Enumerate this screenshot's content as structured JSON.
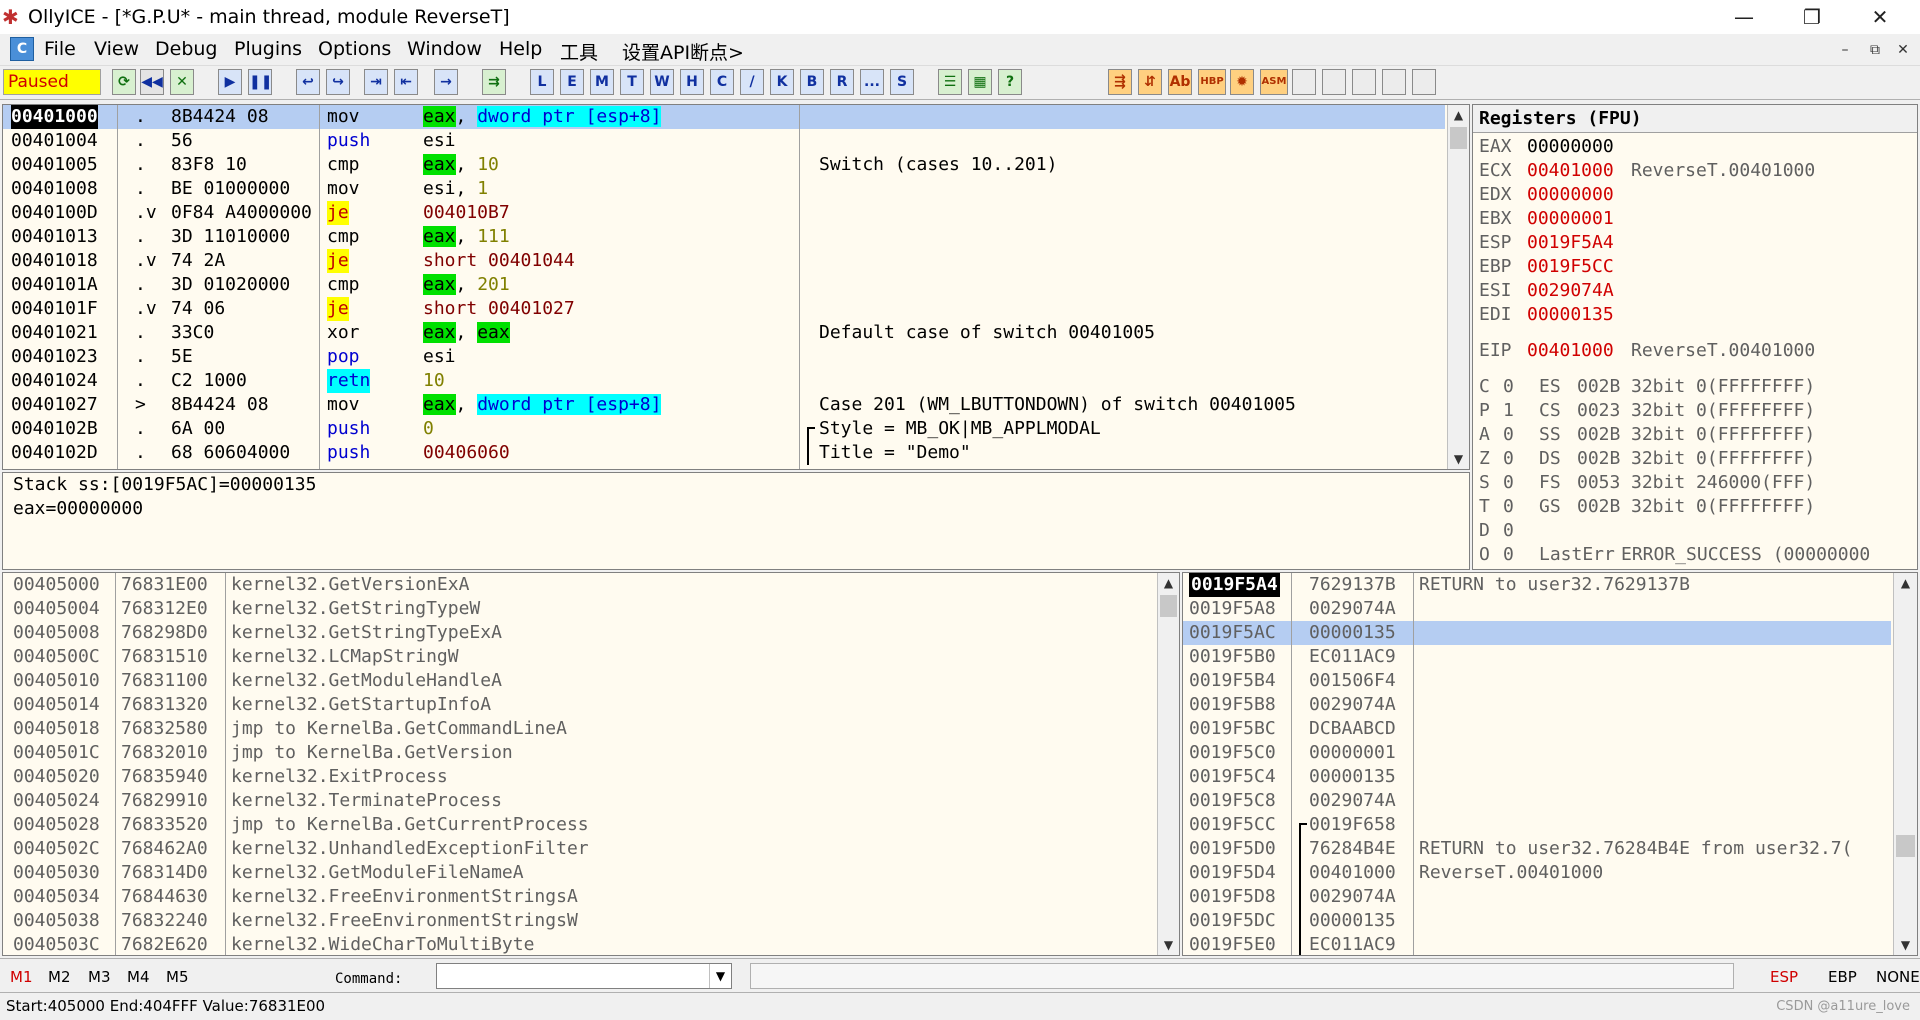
{
  "window": {
    "title": "OllyICE - [*G.P.U* - main thread, module ReverseT]",
    "minimize": "—",
    "restore": "❐",
    "close": "✕"
  },
  "menu": {
    "items": [
      "File",
      "View",
      "Debug",
      "Plugins",
      "Options",
      "Window",
      "Help",
      "工具",
      "设置API断点>"
    ],
    "mdi_buttons": [
      "–",
      "⧉",
      "✕"
    ]
  },
  "toolbar": {
    "status": "Paused",
    "buttons": [
      "⟳",
      "◀◀",
      "✕",
      "▶",
      "❚❚",
      "↩",
      "↪",
      "⇥",
      "⇤",
      "→",
      "⇉",
      "L",
      "E",
      "M",
      "T",
      "W",
      "H",
      "C",
      "/",
      "K",
      "B",
      "R",
      "...",
      "S",
      "☰",
      "▦",
      "?",
      "⇶",
      "⇵",
      "Ab",
      "HBP",
      "✹",
      "ASM"
    ]
  },
  "colors": {
    "selection": "#b5cdf2",
    "pane_bg": "#fffbf0",
    "reg_changed": "#d00000",
    "operand_reg_bg": "#00e000",
    "mem_operand_bg": "#00ffff",
    "jump_bg": "#ffff00"
  },
  "disasm": {
    "rows": [
      {
        "addr": "00401000",
        "mark": ".",
        "hex": "8B4424 08",
        "op": "mov",
        "args": [
          {
            "t": "eax",
            "s": "reg"
          },
          {
            "t": ", ",
            "s": ""
          },
          {
            "t": "dword ptr [esp+8]",
            "s": "mem"
          }
        ],
        "comment": "",
        "selected": true
      },
      {
        "addr": "00401004",
        "mark": ".",
        "hex": "56",
        "op": "push",
        "opstyle": "blue",
        "args": [
          {
            "t": "esi",
            "s": ""
          }
        ],
        "comment": ""
      },
      {
        "addr": "00401005",
        "mark": ".",
        "hex": "83F8 10",
        "op": "cmp",
        "args": [
          {
            "t": "eax",
            "s": "reg"
          },
          {
            "t": ", ",
            "s": ""
          },
          {
            "t": "10",
            "s": "num"
          }
        ],
        "comment": "Switch (cases 10..201)"
      },
      {
        "addr": "00401008",
        "mark": ".",
        "hex": "BE 01000000",
        "op": "mov",
        "args": [
          {
            "t": "esi",
            "s": ""
          },
          {
            "t": ", ",
            "s": ""
          },
          {
            "t": "1",
            "s": "num"
          }
        ],
        "comment": ""
      },
      {
        "addr": "0040100D",
        "mark": ".v",
        "hex": "0F84 A4000000",
        "op": "je",
        "opstyle": "jump",
        "args": [
          {
            "t": "004010B7",
            "s": "addr"
          }
        ],
        "comment": ""
      },
      {
        "addr": "00401013",
        "mark": ".",
        "hex": "3D 11010000",
        "op": "cmp",
        "args": [
          {
            "t": "eax",
            "s": "reg"
          },
          {
            "t": ", ",
            "s": ""
          },
          {
            "t": "111",
            "s": "num"
          }
        ],
        "comment": ""
      },
      {
        "addr": "00401018",
        "mark": ".v",
        "hex": "74 2A",
        "op": "je",
        "opstyle": "jump",
        "args": [
          {
            "t": "short 00401044",
            "s": "addr"
          }
        ],
        "comment": ""
      },
      {
        "addr": "0040101A",
        "mark": ".",
        "hex": "3D 01020000",
        "op": "cmp",
        "args": [
          {
            "t": "eax",
            "s": "reg"
          },
          {
            "t": ", ",
            "s": ""
          },
          {
            "t": "201",
            "s": "num"
          }
        ],
        "comment": ""
      },
      {
        "addr": "0040101F",
        "mark": ".v",
        "hex": "74 06",
        "op": "je",
        "opstyle": "jump",
        "args": [
          {
            "t": "short 00401027",
            "s": "addr"
          }
        ],
        "comment": ""
      },
      {
        "addr": "00401021",
        "mark": ".",
        "hex": "33C0",
        "op": "xor",
        "args": [
          {
            "t": "eax",
            "s": "reg"
          },
          {
            "t": ", ",
            "s": ""
          },
          {
            "t": "eax",
            "s": "reg"
          }
        ],
        "comment": "Default case of switch 00401005"
      },
      {
        "addr": "00401023",
        "mark": ".",
        "hex": "5E",
        "op": "pop",
        "opstyle": "blue",
        "args": [
          {
            "t": "esi",
            "s": ""
          }
        ],
        "comment": ""
      },
      {
        "addr": "00401024",
        "mark": ".",
        "hex": "C2 1000",
        "op": "retn",
        "opstyle": "ret",
        "args": [
          {
            "t": "10",
            "s": "num"
          }
        ],
        "comment": ""
      },
      {
        "addr": "00401027",
        "mark": ">",
        "hex": "8B4424 08",
        "op": "mov",
        "args": [
          {
            "t": "eax",
            "s": "reg"
          },
          {
            "t": ", ",
            "s": ""
          },
          {
            "t": "dword ptr [esp+8]",
            "s": "mem"
          }
        ],
        "comment": "Case 201 (WM_LBUTTONDOWN) of switch 00401005"
      },
      {
        "addr": "0040102B",
        "mark": ".",
        "hex": "6A 00",
        "op": "push",
        "opstyle": "blue",
        "args": [
          {
            "t": "0",
            "s": "num"
          }
        ],
        "comment": "Style = MB_OK|MB_APPLMODAL",
        "bracket": "start"
      },
      {
        "addr": "0040102D",
        "mark": ".",
        "hex": "68 60604000",
        "op": "push",
        "opstyle": "blue",
        "args": [
          {
            "t": "00406060",
            "s": "addr"
          }
        ],
        "comment": "Title = \"Demo\"",
        "bracket": "mid"
      }
    ]
  },
  "info": {
    "line1": "Stack ss:[0019F5AC]=00000135",
    "line2": "eax=00000000"
  },
  "registers": {
    "header": "Registers (FPU)",
    "gp": [
      {
        "name": "EAX",
        "value": "00000000",
        "note": "",
        "changed": false
      },
      {
        "name": "ECX",
        "value": "00401000",
        "note": "ReverseT.00401000",
        "changed": true
      },
      {
        "name": "EDX",
        "value": "00000000",
        "note": "",
        "changed": true
      },
      {
        "name": "EBX",
        "value": "00000001",
        "note": "",
        "changed": true
      },
      {
        "name": "ESP",
        "value": "0019F5A4",
        "note": "",
        "changed": true
      },
      {
        "name": "EBP",
        "value": "0019F5CC",
        "note": "",
        "changed": true
      },
      {
        "name": "ESI",
        "value": "0029074A",
        "note": "",
        "changed": true
      },
      {
        "name": "EDI",
        "value": "00000135",
        "note": "",
        "changed": true
      }
    ],
    "eip": {
      "name": "EIP",
      "value": "00401000",
      "note": "ReverseT.00401000"
    },
    "flags": [
      {
        "f": "C",
        "v": "0",
        "seg": "ES",
        "sel": "002B",
        "desc": "32bit 0(FFFFFFFF)"
      },
      {
        "f": "P",
        "v": "1",
        "seg": "CS",
        "sel": "0023",
        "desc": "32bit 0(FFFFFFFF)"
      },
      {
        "f": "A",
        "v": "0",
        "seg": "SS",
        "sel": "002B",
        "desc": "32bit 0(FFFFFFFF)"
      },
      {
        "f": "Z",
        "v": "0",
        "seg": "DS",
        "sel": "002B",
        "desc": "32bit 0(FFFFFFFF)"
      },
      {
        "f": "S",
        "v": "0",
        "seg": "FS",
        "sel": "0053",
        "desc": "32bit 246000(FFF)"
      },
      {
        "f": "T",
        "v": "0",
        "seg": "GS",
        "sel": "002B",
        "desc": "32bit 0(FFFFFFFF)"
      },
      {
        "f": "D",
        "v": "0",
        "seg": "",
        "sel": "",
        "desc": ""
      },
      {
        "f": "O",
        "v": "0",
        "seg": "",
        "sel": "LastErr",
        "desc": "ERROR_SUCCESS (00000000"
      }
    ]
  },
  "dump": {
    "rows": [
      {
        "addr": "00405000",
        "val": "76831E00",
        "text": "kernel32.GetVersionExA"
      },
      {
        "addr": "00405004",
        "val": "768312E0",
        "text": "kernel32.GetStringTypeW"
      },
      {
        "addr": "00405008",
        "val": "768298D0",
        "text": "kernel32.GetStringTypeExA"
      },
      {
        "addr": "0040500C",
        "val": "76831510",
        "text": "kernel32.LCMapStringW"
      },
      {
        "addr": "00405010",
        "val": "76831100",
        "text": "kernel32.GetModuleHandleA"
      },
      {
        "addr": "00405014",
        "val": "76831320",
        "text": "kernel32.GetStartupInfoA"
      },
      {
        "addr": "00405018",
        "val": "76832580",
        "text": "jmp to KernelBa.GetCommandLineA"
      },
      {
        "addr": "0040501C",
        "val": "76832010",
        "text": "jmp to KernelBa.GetVersion"
      },
      {
        "addr": "00405020",
        "val": "76835940",
        "text": "kernel32.ExitProcess"
      },
      {
        "addr": "00405024",
        "val": "76829910",
        "text": "kernel32.TerminateProcess"
      },
      {
        "addr": "00405028",
        "val": "76833520",
        "text": "jmp to KernelBa.GetCurrentProcess"
      },
      {
        "addr": "0040502C",
        "val": "768462A0",
        "text": "kernel32.UnhandledExceptionFilter"
      },
      {
        "addr": "00405030",
        "val": "768314D0",
        "text": "kernel32.GetModuleFileNameA"
      },
      {
        "addr": "00405034",
        "val": "76844630",
        "text": "kernel32.FreeEnvironmentStringsA"
      },
      {
        "addr": "00405038",
        "val": "76832240",
        "text": "kernel32.FreeEnvironmentStringsW"
      },
      {
        "addr": "0040503C",
        "val": "7682E620",
        "text": "kernel32.WideCharToMultiByte"
      }
    ]
  },
  "stack": {
    "rows": [
      {
        "addr": "0019F5A4",
        "val": "7629137B",
        "text": "RETURN to user32.7629137B",
        "cur": true
      },
      {
        "addr": "0019F5A8",
        "val": "0029074A",
        "text": ""
      },
      {
        "addr": "0019F5AC",
        "val": "00000135",
        "text": "",
        "selected": true
      },
      {
        "addr": "0019F5B0",
        "val": "EC011AC9",
        "text": ""
      },
      {
        "addr": "0019F5B4",
        "val": "001506F4",
        "text": ""
      },
      {
        "addr": "0019F5B8",
        "val": "0029074A",
        "text": ""
      },
      {
        "addr": "0019F5BC",
        "val": "DCBAABCD",
        "text": ""
      },
      {
        "addr": "0019F5C0",
        "val": "00000001",
        "text": ""
      },
      {
        "addr": "0019F5C4",
        "val": "00000135",
        "text": ""
      },
      {
        "addr": "0019F5C8",
        "val": "0029074A",
        "text": ""
      },
      {
        "addr": "0019F5CC",
        "val": "0019F658",
        "text": "",
        "bracket": "start"
      },
      {
        "addr": "0019F5D0",
        "val": "76284B4E",
        "text": "RETURN to user32.76284B4E from user32.7(",
        "bracket": "mid"
      },
      {
        "addr": "0019F5D4",
        "val": "00401000",
        "text": "ReverseT.00401000",
        "bracket": "mid"
      },
      {
        "addr": "0019F5D8",
        "val": "0029074A",
        "text": "",
        "bracket": "mid"
      },
      {
        "addr": "0019F5DC",
        "val": "00000135",
        "text": "",
        "bracket": "mid"
      },
      {
        "addr": "0019F5E0",
        "val": "EC011AC9",
        "text": "",
        "bracket": "mid"
      }
    ]
  },
  "bottom": {
    "marks": [
      "M1",
      "M2",
      "M3",
      "M4",
      "M5"
    ],
    "command_label": "Command:",
    "command_value": "",
    "regs": [
      "ESP",
      "EBP",
      "NONE"
    ]
  },
  "status": {
    "text": "Start:405000 End:404FFF Value:76831E00",
    "watermark": "CSDN @a11ure_love"
  }
}
